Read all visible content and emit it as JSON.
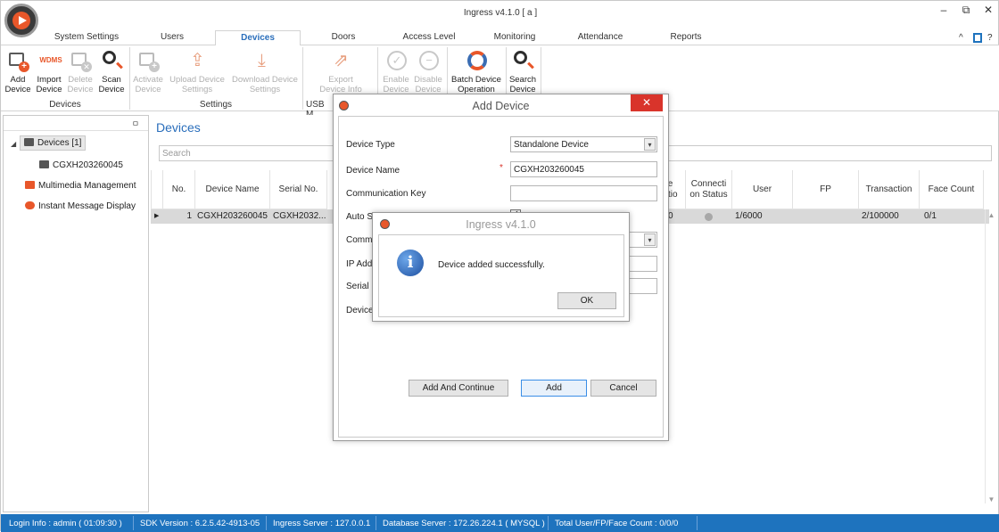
{
  "app": {
    "title": "Ingress v4.1.0 [ a ]"
  },
  "window_controls": {
    "minimize": "‒",
    "restore": "⧉",
    "close": "✕"
  },
  "menu": {
    "tabs": [
      "System Settings",
      "Users",
      "Devices",
      "Doors",
      "Access Level",
      "Monitoring",
      "Attendance",
      "Reports"
    ],
    "active": "Devices",
    "right_icons": [
      "?",
      "^"
    ]
  },
  "ribbon": {
    "devices_group": {
      "label": "Devices",
      "buttons": [
        {
          "label": "Add Device",
          "icon": "add-device-icon",
          "enabled": true
        },
        {
          "label": "Import Device",
          "icon": "wdms-icon",
          "icon_text": "WDMS",
          "enabled": true
        },
        {
          "label": "Delete Device",
          "icon": "delete-device-icon",
          "enabled": false
        },
        {
          "label": "Scan Device",
          "icon": "search-icon",
          "enabled": true
        }
      ]
    },
    "settings_group": {
      "label": "Settings",
      "buttons": [
        {
          "label": "Activate Device",
          "enabled": false
        },
        {
          "label": "Upload Device Settings",
          "enabled": false
        },
        {
          "label": "Download Device Settings",
          "enabled": false
        }
      ]
    },
    "usb_group": {
      "label": "USB M",
      "buttons": [
        {
          "label": "Export Device Info",
          "enabled": false
        }
      ]
    },
    "other_buttons": [
      {
        "label": "Enable Device",
        "enabled": false
      },
      {
        "label": "Disable Device",
        "enabled": false
      },
      {
        "label": "Batch Device Operation",
        "enabled": true
      },
      {
        "label": "Search Device",
        "enabled": true
      }
    ]
  },
  "tree": {
    "pin": "ㅁ",
    "items": [
      {
        "label": "Devices [1]",
        "expanded": true,
        "selected": true
      },
      {
        "label": "CGXH203260045"
      },
      {
        "label": "Multimedia Management"
      },
      {
        "label": "Instant Message Display"
      }
    ]
  },
  "main": {
    "title": "Devices",
    "search_placeholder": "Search",
    "columns": [
      "No.",
      "Device Name",
      "Serial No.",
      "e\natio",
      "Connecti\non Status",
      "User",
      "FP",
      "Transaction",
      "Face Count"
    ],
    "rows": [
      {
        "no": "1",
        "device_name": "CGXH203260045",
        "serial_no": "CGXH2032...",
        "col_partial": "0",
        "connection": "gray",
        "user": "1/6000",
        "fp": "",
        "transaction": "2/100000",
        "face_count": "0/1"
      }
    ]
  },
  "add_device_dialog": {
    "title": "Add Device",
    "fields": {
      "device_type_label": "Device Type",
      "device_type_value": "Standalone Device",
      "device_name_label": "Device Name",
      "device_name_value": "CGXH203260045",
      "comm_key_label": "Communication Key",
      "comm_key_value": "",
      "auto_sync_label": "Auto Synchronize Device Time",
      "auto_sync_checked": true,
      "comm_type_label_partial": "Commu",
      "ip_label_partial": "IP Addr",
      "serial_label_partial": "Serial N",
      "device_label_partial": "Device"
    },
    "buttons": {
      "add_continue": "Add And Continue",
      "add": "Add",
      "cancel": "Cancel"
    }
  },
  "message_box": {
    "title": "Ingress v4.1.0",
    "message": "Device added successfully.",
    "ok": "OK",
    "icon": "info-icon"
  },
  "status_bar": {
    "login": "Login Info : admin ( 01:09:30 )",
    "sdk": "SDK Version : 6.2.5.42-4913-05",
    "ingress_server": "Ingress Server : 127.0.0.1",
    "db_server": "Database Server : 172.26.224.1 ( MYSQL )",
    "totals": "Total User/FP/Face Count : 0/0/0"
  },
  "colors": {
    "accent": "#2a6ebb",
    "status_bar": "#1e73be",
    "brand_orange": "#e8572a",
    "close_red": "#d9342b"
  }
}
